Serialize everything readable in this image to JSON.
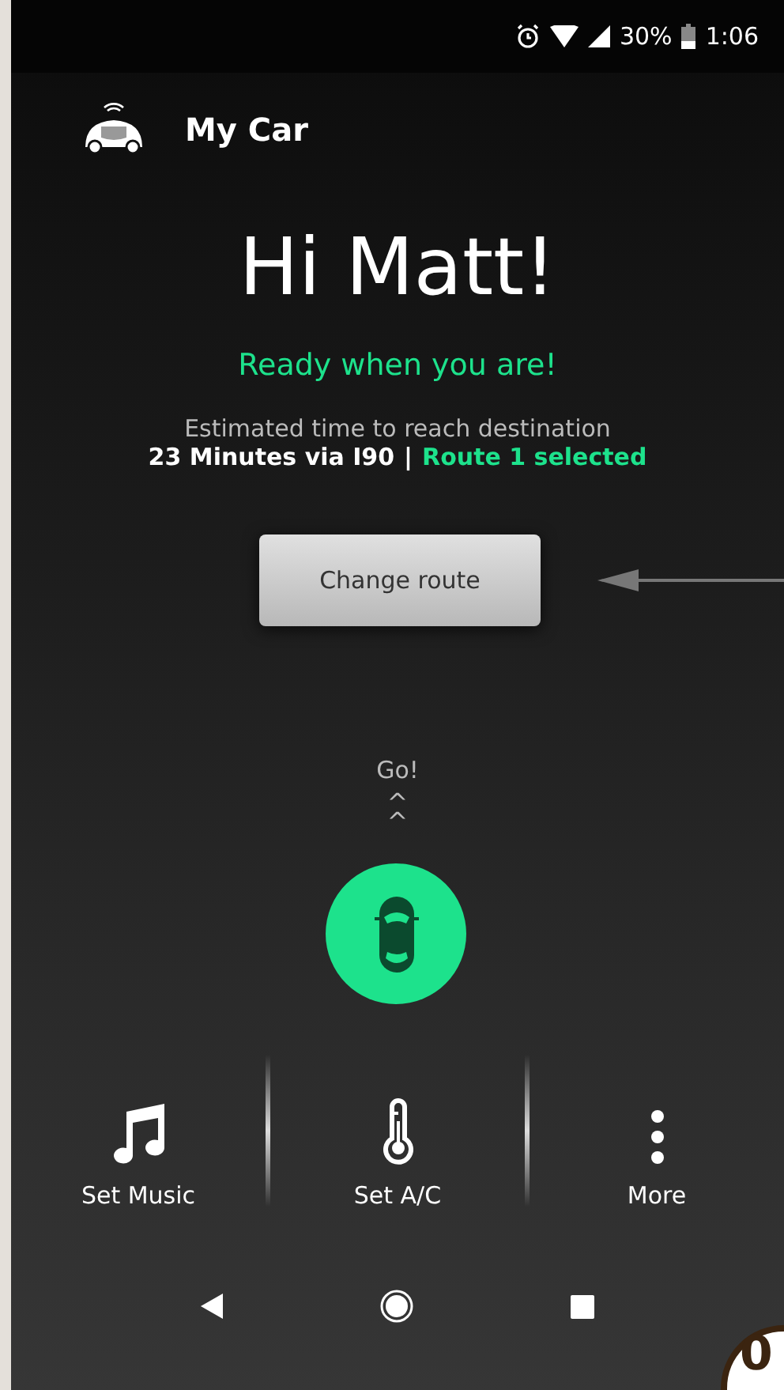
{
  "status_bar": {
    "battery": "30%",
    "time": "1:06"
  },
  "header": {
    "title": "My Car"
  },
  "greeting": "Hi Matt!",
  "status_message": "Ready when you are!",
  "estimate": {
    "label": "Estimated time to reach destination",
    "route_info": "23 Minutes via I90",
    "separator": "|",
    "route_selected": "Route 1 selected"
  },
  "change_route_button": "Change route",
  "go": {
    "label": "Go!",
    "chevrons": [
      "^",
      "^"
    ]
  },
  "actions": [
    {
      "kind": "music",
      "label": "Set Music"
    },
    {
      "kind": "thermometer",
      "label": "Set A/C"
    },
    {
      "kind": "more",
      "label": "More"
    }
  ],
  "annotation_badge": "0"
}
